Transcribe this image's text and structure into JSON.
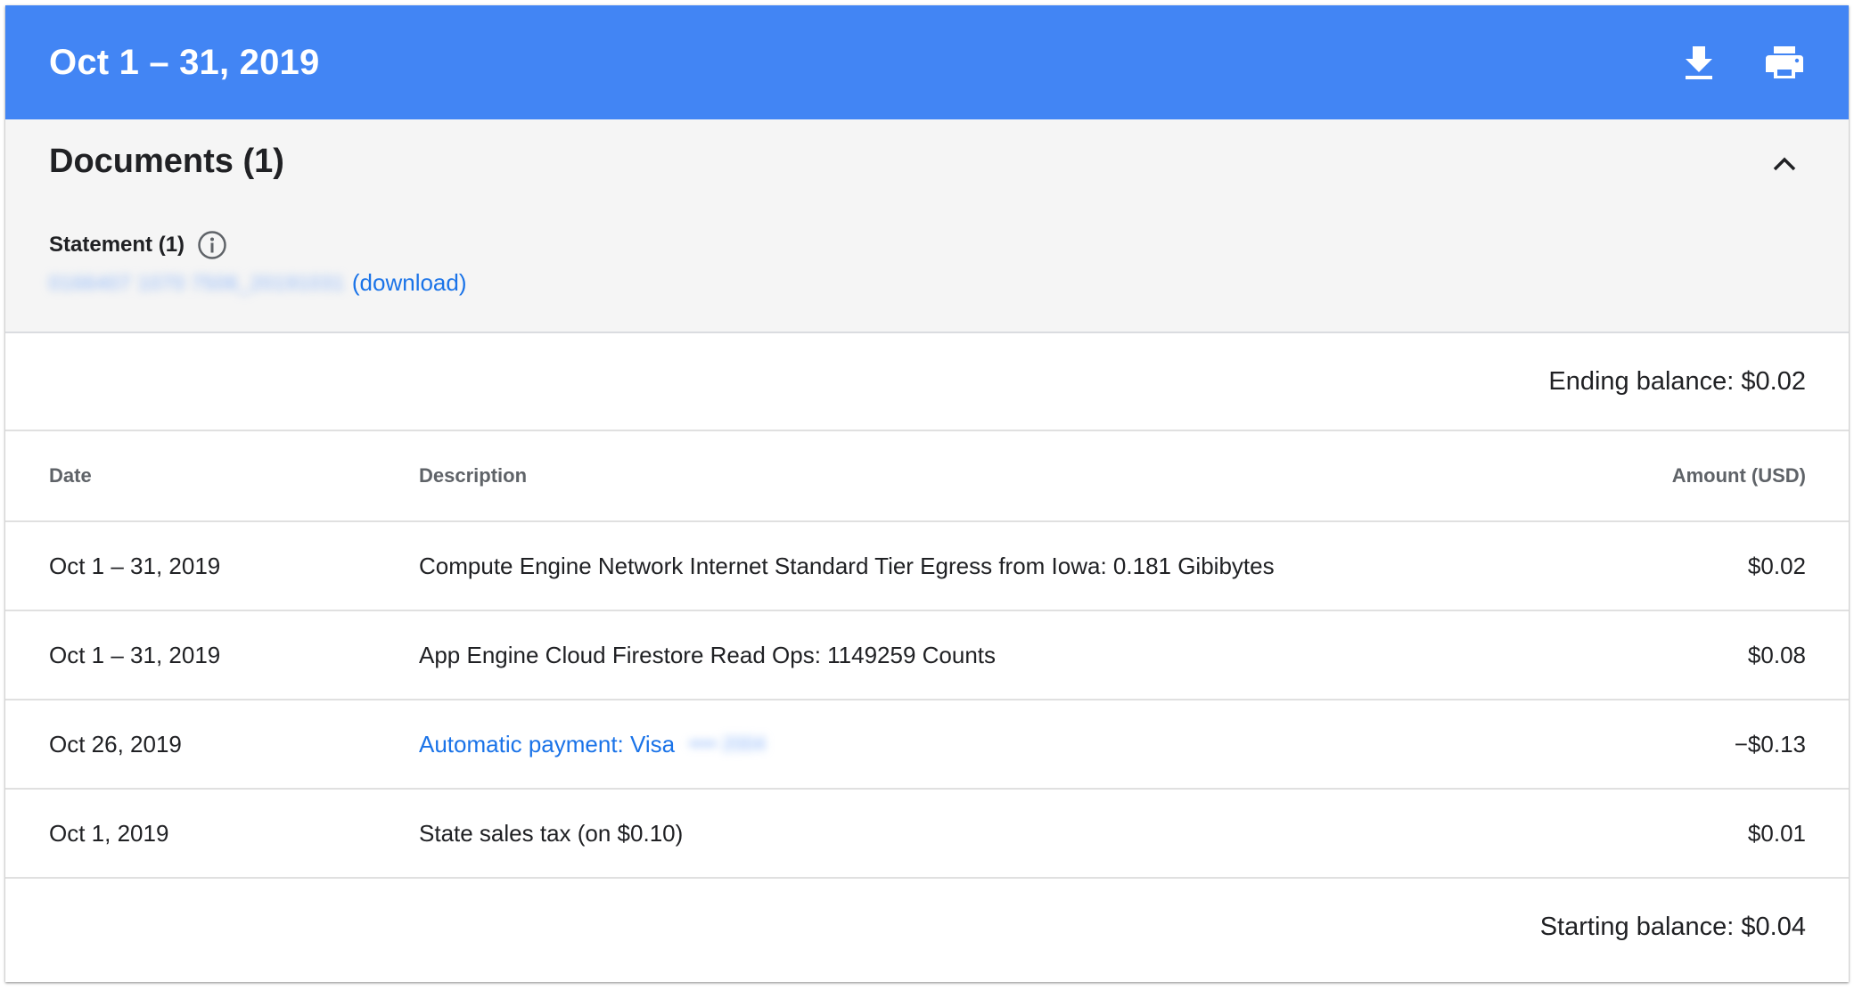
{
  "header": {
    "title": "Oct 1 – 31, 2019",
    "background_color": "#4285f4",
    "icons": [
      "download-icon",
      "print-icon"
    ]
  },
  "documents": {
    "title": "Documents (1)",
    "statement_label": "Statement (1)",
    "file_name": "0166407 1070 7506_20191031",
    "download_link": "(download)",
    "icons": [
      "chevron-up-icon",
      "info-icon"
    ]
  },
  "ending_balance": "Ending balance: $0.02",
  "table": {
    "columns": [
      "Date",
      "Description",
      "Amount (USD)"
    ],
    "rows": [
      {
        "date": "Oct 1 – 31, 2019",
        "description": "Compute Engine Network Internet Standard Tier Egress from Iowa: 0.181 Gibibytes",
        "amount": "$0.02"
      },
      {
        "date": "Oct 1 – 31, 2019",
        "description": "App Engine Cloud Firestore Read Ops: 1149259 Counts",
        "amount": "$0.08"
      },
      {
        "date": "Oct 26, 2019",
        "description": "Automatic payment: Visa",
        "card_masked": "•••• 2004",
        "amount": "−$0.13"
      },
      {
        "date": "Oct 1, 2019",
        "description": "State sales tax (on $0.10)",
        "amount": "$0.01"
      }
    ]
  },
  "starting_balance": "Starting balance: $0.04",
  "colors": {
    "accent": "#4285f4",
    "link": "#1a73e8",
    "docs_background": "#f5f5f5"
  }
}
